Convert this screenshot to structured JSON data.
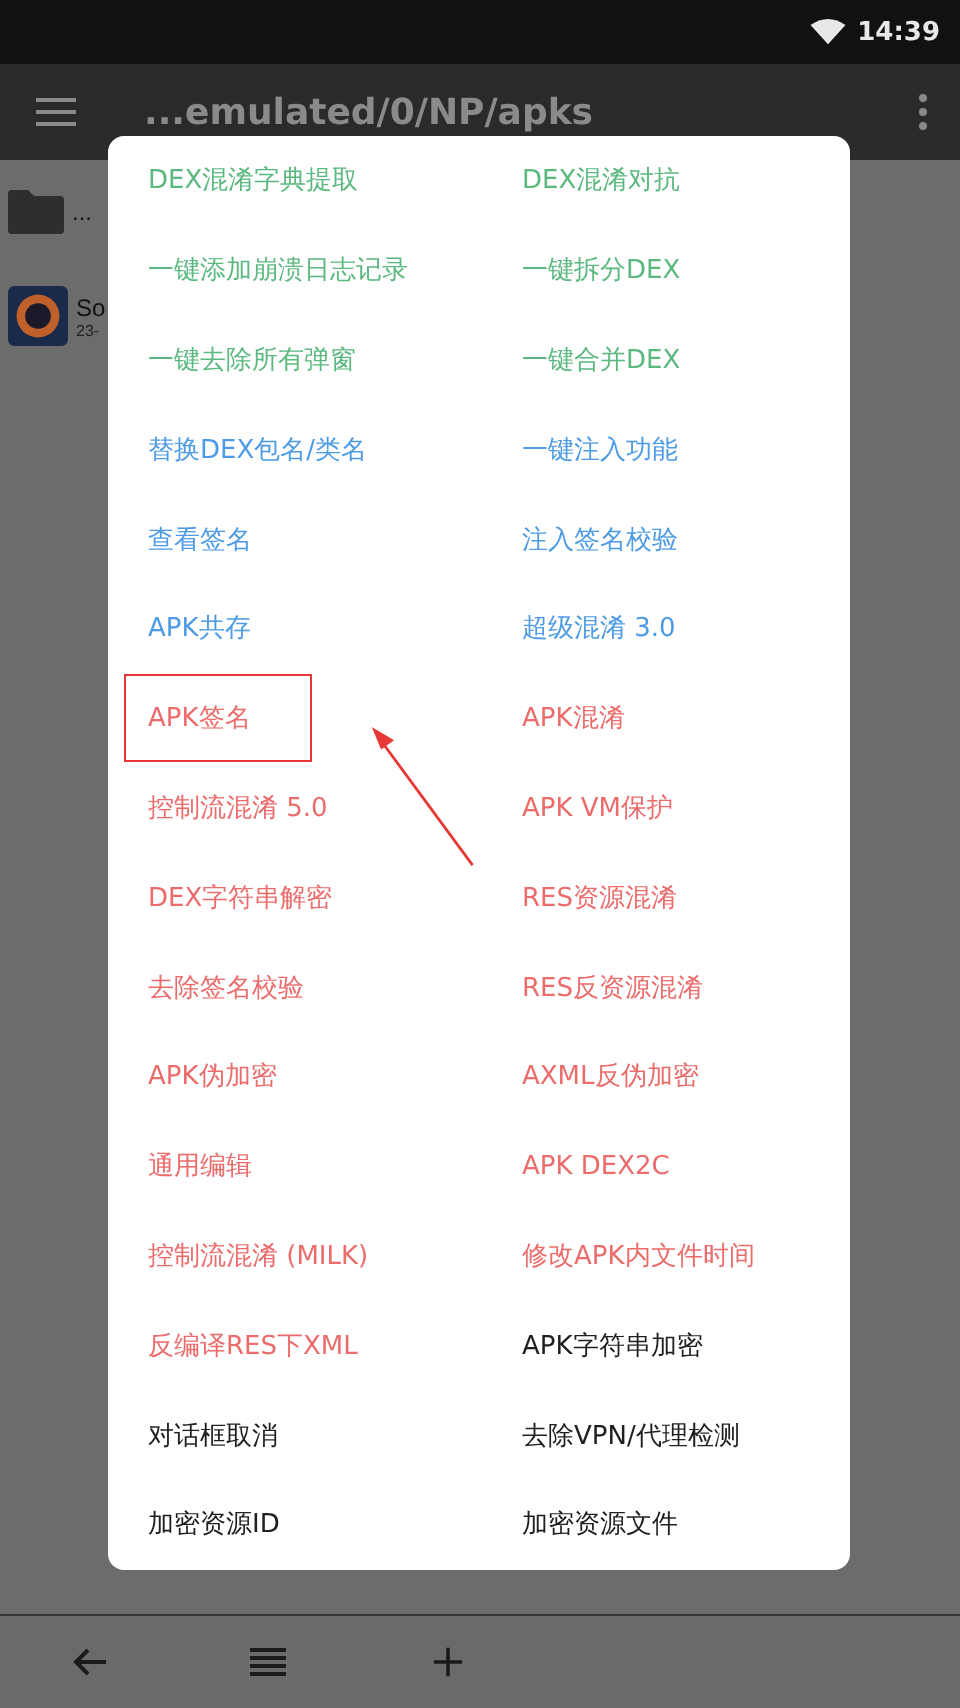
{
  "status_bar": {
    "time": "14:39"
  },
  "toolbar": {
    "title": "...emulated/0/NP/apks"
  },
  "files": [
    {
      "kind": "folder",
      "name": "..."
    },
    {
      "kind": "app",
      "name": "So",
      "detail": "23-"
    }
  ],
  "menu": {
    "items": [
      {
        "label": "DEX混淆字典提取",
        "color": "#5bb97f",
        "highlighted": false
      },
      {
        "label": "DEX混淆对抗",
        "color": "#5bb97f",
        "highlighted": false
      },
      {
        "label": "一键添加崩溃日志记录",
        "color": "#5bb97f",
        "highlighted": false
      },
      {
        "label": "一键拆分DEX",
        "color": "#5bb97f",
        "highlighted": false
      },
      {
        "label": "一键去除所有弹窗",
        "color": "#5bb97f",
        "highlighted": false
      },
      {
        "label": "一键合并DEX",
        "color": "#5bb97f",
        "highlighted": false
      },
      {
        "label": "替换DEX包名/类名",
        "color": "#4d9be6",
        "highlighted": false
      },
      {
        "label": "一键注入功能",
        "color": "#4d9be6",
        "highlighted": false
      },
      {
        "label": "查看签名",
        "color": "#4d9be6",
        "highlighted": false
      },
      {
        "label": "注入签名校验",
        "color": "#4d9be6",
        "highlighted": false
      },
      {
        "label": "APK共存",
        "color": "#4d9be6",
        "highlighted": false
      },
      {
        "label": "超级混淆 3.0",
        "color": "#4d9be6",
        "highlighted": false
      },
      {
        "label": "APK签名",
        "color": "#ec6b6b",
        "highlighted": true
      },
      {
        "label": "APK混淆",
        "color": "#ec6b6b",
        "highlighted": false
      },
      {
        "label": "控制流混淆 5.0",
        "color": "#ec6b6b",
        "highlighted": false
      },
      {
        "label": "APK VM保护",
        "color": "#ec6b6b",
        "highlighted": false
      },
      {
        "label": "DEX字符串解密",
        "color": "#ec6b6b",
        "highlighted": false
      },
      {
        "label": "RES资源混淆",
        "color": "#ec6b6b",
        "highlighted": false
      },
      {
        "label": "去除签名校验",
        "color": "#ec6b6b",
        "highlighted": false
      },
      {
        "label": "RES反资源混淆",
        "color": "#ec6b6b",
        "highlighted": false
      },
      {
        "label": "APK伪加密",
        "color": "#ec6b6b",
        "highlighted": false
      },
      {
        "label": "AXML反伪加密",
        "color": "#ec6b6b",
        "highlighted": false
      },
      {
        "label": "通用编辑",
        "color": "#ec6b6b",
        "highlighted": false
      },
      {
        "label": "APK DEX2C",
        "color": "#ec6b6b",
        "highlighted": false
      },
      {
        "label": "控制流混淆 (MILK)",
        "color": "#ec6b6b",
        "highlighted": false
      },
      {
        "label": "修改APK内文件时间",
        "color": "#ec6b6b",
        "highlighted": false
      },
      {
        "label": "反编译RES下XML",
        "color": "#ec6b6b",
        "highlighted": false
      },
      {
        "label": "APK字符串加密",
        "color": "#1f1f1f",
        "highlighted": false
      },
      {
        "label": "对话框取消",
        "color": "#1f1f1f",
        "highlighted": false
      },
      {
        "label": "去除VPN/代理检测",
        "color": "#1f1f1f",
        "highlighted": false
      },
      {
        "label": "加密资源ID",
        "color": "#1f1f1f",
        "highlighted": false
      },
      {
        "label": "加密资源文件",
        "color": "#1f1f1f",
        "highlighted": false
      }
    ]
  }
}
